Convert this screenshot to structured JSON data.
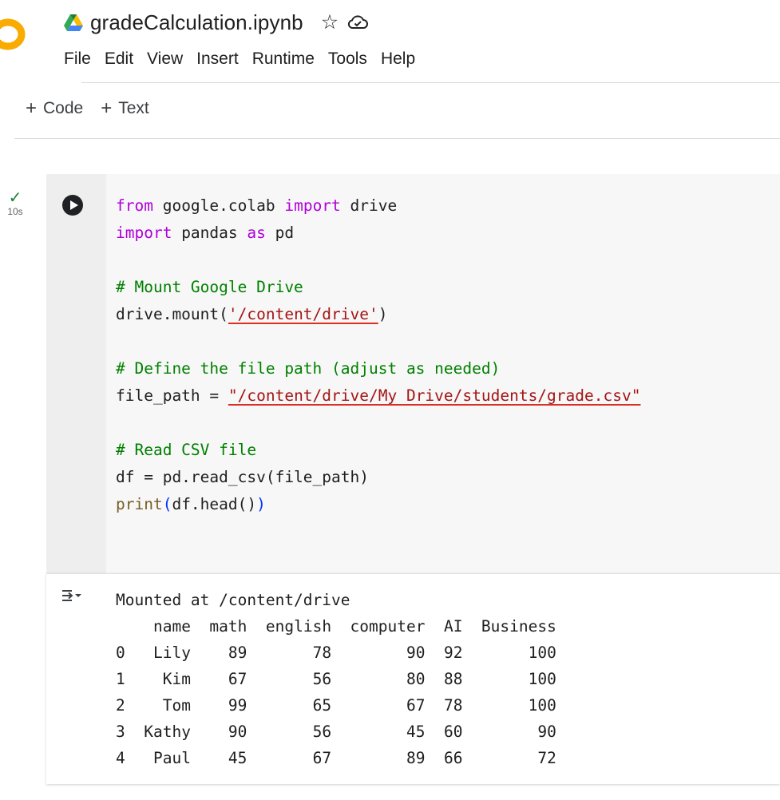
{
  "header": {
    "notebook_title": "gradeCalculation.ipynb",
    "star_icon": "star-outline-icon",
    "cloud_icon": "cloud-saved-icon",
    "drive_icon": "google-drive-icon",
    "logo_icon": "colab-logo-icon"
  },
  "menu": {
    "items": [
      "File",
      "Edit",
      "View",
      "Insert",
      "Runtime",
      "Tools",
      "Help"
    ]
  },
  "toolbar": {
    "add_code_label": "Code",
    "add_text_label": "Text"
  },
  "cell": {
    "status_icon": "check-icon",
    "exec_time": "10s",
    "code_lines": [
      "from google.colab import drive",
      "import pandas as pd",
      "",
      "# Mount Google Drive",
      "drive.mount('/content/drive')",
      "",
      "# Define the file path (adjust as needed)",
      "file_path = \"/content/drive/My Drive/students/grade.csv\"",
      "",
      "# Read CSV file",
      "df = pd.read_csv(file_path)",
      "print(df.head())"
    ]
  },
  "output": {
    "mounted_message": "Mounted at /content/drive",
    "table": {
      "columns": [
        "name",
        "math",
        "english",
        "computer",
        "AI",
        "Business"
      ],
      "rows": [
        {
          "index": "0",
          "name": "Lily",
          "math": "89",
          "english": "78",
          "computer": "90",
          "AI": "92",
          "Business": "100"
        },
        {
          "index": "1",
          "name": "Kim",
          "math": "67",
          "english": "56",
          "computer": "80",
          "AI": "88",
          "Business": "100"
        },
        {
          "index": "2",
          "name": "Tom",
          "math": "99",
          "english": "65",
          "computer": "67",
          "AI": "78",
          "Business": "100"
        },
        {
          "index": "3",
          "name": "Kathy",
          "math": "90",
          "english": "56",
          "computer": "45",
          "AI": "60",
          "Business": "90"
        },
        {
          "index": "4",
          "name": "Paul",
          "math": "45",
          "english": "67",
          "computer": "89",
          "AI": "66",
          "Business": "72"
        }
      ]
    }
  },
  "colors": {
    "keyword": "#af00db",
    "comment": "#008000",
    "string": "#a31515",
    "builtin": "#795e26",
    "paren": "#0431fa",
    "success": "#188038"
  }
}
